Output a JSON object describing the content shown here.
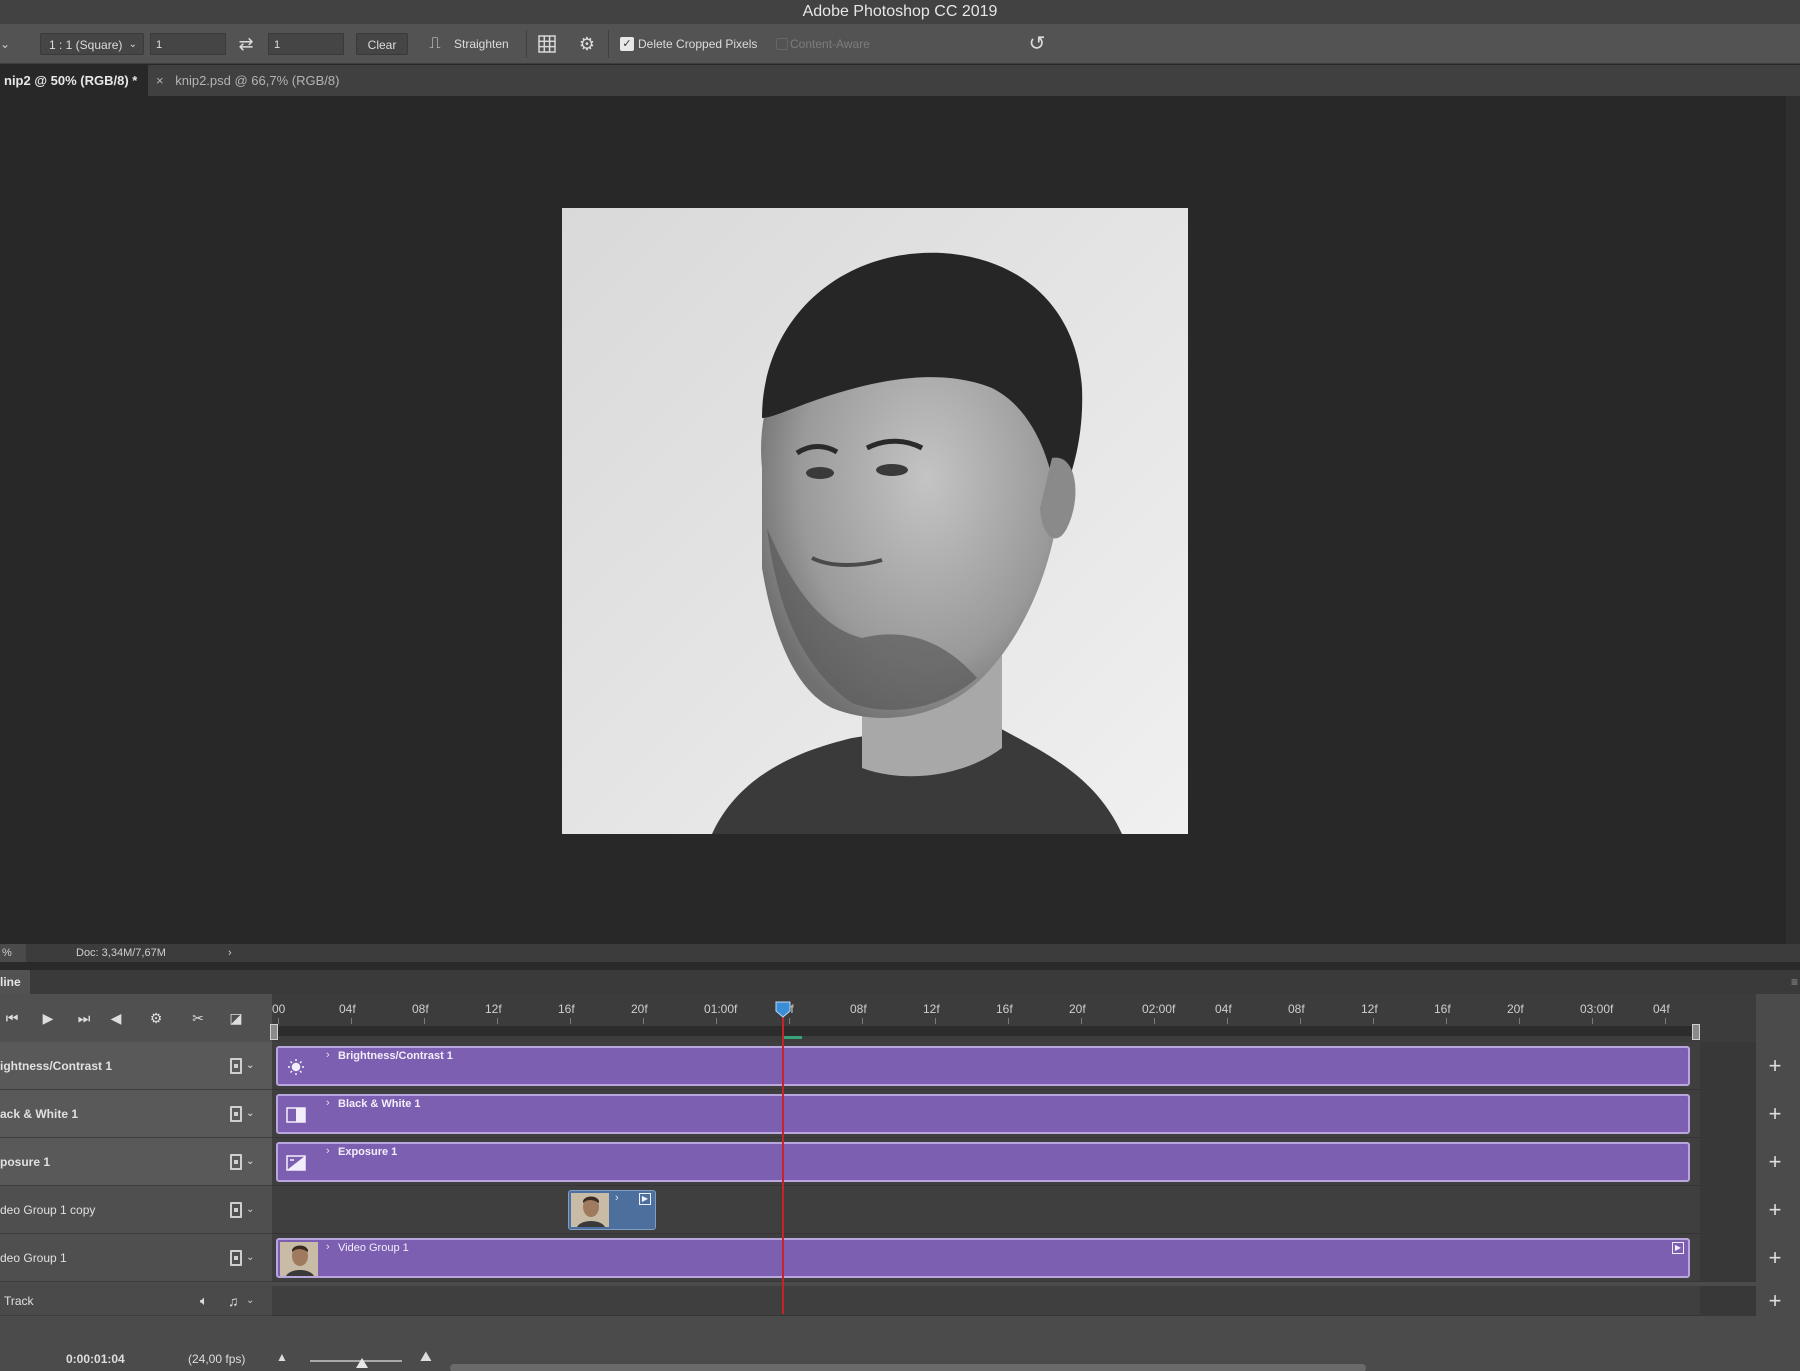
{
  "app": {
    "title": "Adobe Photoshop CC 2019"
  },
  "options": {
    "tool_dropdown": "⌄",
    "ratio": "1 : 1 (Square)",
    "width_value": "1",
    "height_value": "1",
    "clear_label": "Clear",
    "straighten_label": "Straighten",
    "delete_cropped_label": "Delete Cropped Pixels",
    "delete_cropped_checked": true,
    "content_aware_label": "Content-Aware",
    "content_aware_checked": false
  },
  "document_tabs": [
    {
      "label": "nip2 @ 50% (RGB/8) *",
      "active": true
    },
    {
      "label": "knip2.psd @ 66,7% (RGB/8)",
      "active": false,
      "close": "×"
    }
  ],
  "status_bar": {
    "zoom": "%",
    "doc_info": "Doc: 3,34M/7,67M",
    "arrow": "›"
  },
  "timeline": {
    "panel_title": "line",
    "menu_icon": "≡",
    "ruler_labels": [
      "00",
      "04f",
      "08f",
      "12f",
      "16f",
      "20f",
      "01:00f",
      "04f",
      "08f",
      "12f",
      "16f",
      "20f",
      "02:00f",
      "04f",
      "08f",
      "12f",
      "16f",
      "20f",
      "03:00f",
      "04f"
    ],
    "playhead_frame": 28,
    "tracks": [
      {
        "label": "ightness/Contrast 1",
        "clip_title": "Brightness/Contrast 1",
        "type": "adjustment",
        "icon": "sun-icon"
      },
      {
        "label": "ack & White 1",
        "clip_title": "Black & White 1",
        "type": "adjustment",
        "icon": "bw-icon"
      },
      {
        "label": "posure 1",
        "clip_title": "Exposure 1",
        "type": "adjustment",
        "icon": "exposure-icon"
      },
      {
        "label": "deo Group 1 copy",
        "clip_title": "",
        "type": "video-copy"
      },
      {
        "label": "deo Group 1",
        "clip_title": "Video Group 1",
        "type": "video"
      }
    ],
    "audio_track": {
      "label": "Track"
    },
    "timecode": "0:00:01:04",
    "fps": "(24,00 fps)",
    "add_symbol": "+",
    "chevron": "›"
  },
  "colors": {
    "clip_purple": "#7c5fb0",
    "clip_blue": "#4d6f9d",
    "playhead": "#c8232c",
    "playhead_head": "#3a8ed8"
  }
}
